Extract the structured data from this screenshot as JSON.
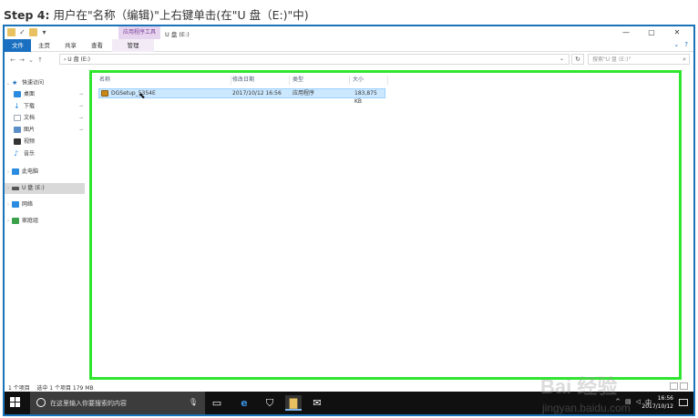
{
  "caption": {
    "step": "Step 4:",
    "text": "用户在\"名称（编辑)\"上右键单击(在\"U 盘（E:)\"中)"
  },
  "window": {
    "title": "U 盘 (E:)",
    "contextual_tab_group": "应用程序工具",
    "controls": {
      "minimize": "—",
      "maximize": "▢",
      "close": "✕"
    }
  },
  "ribbon": {
    "tabs": [
      {
        "label": "文件"
      },
      {
        "label": "主页"
      },
      {
        "label": "共享"
      },
      {
        "label": "查看"
      },
      {
        "label": "管理"
      }
    ],
    "expand": "⌄",
    "help": "?"
  },
  "address": {
    "back": "←",
    "forward": "→",
    "recent": "⌄",
    "up": "↑",
    "path": "› U 盘 (E:)",
    "search_placeholder": "搜索\"U 盘 (E:)\""
  },
  "nav": {
    "items": [
      {
        "label": "快速访问",
        "icon": "star-icon",
        "color": "#1a6fc0"
      },
      {
        "label": "桌面",
        "icon": "desktop-icon",
        "color": "#2a8be0",
        "pinned": true
      },
      {
        "label": "下载",
        "icon": "download-icon",
        "color": "#2a8be0",
        "pinned": true
      },
      {
        "label": "文档",
        "icon": "documents-icon",
        "color": "#9aa5b5",
        "pinned": true
      },
      {
        "label": "图片",
        "icon": "pictures-icon",
        "color": "#5b8fc9",
        "pinned": true
      },
      {
        "label": "视频",
        "icon": "videos-icon",
        "color": "#333333"
      },
      {
        "label": "音乐",
        "icon": "music-icon",
        "color": "#2a8be0"
      },
      {
        "label": "此电脑",
        "icon": "computer-icon",
        "color": "#2a8be0"
      },
      {
        "label": "U 盘 (E:)",
        "icon": "usb-drive-icon",
        "color": "#555555",
        "selected": true
      },
      {
        "label": "网络",
        "icon": "network-icon",
        "color": "#2a8be0"
      },
      {
        "label": "家庭组",
        "icon": "homegroup-icon",
        "color": "#3aa04a"
      }
    ]
  },
  "columns": {
    "name": "名称",
    "modified": "修改日期",
    "type": "类型",
    "size": "大小"
  },
  "files": [
    {
      "name": "DGSetup_5354E",
      "modified": "2017/10/12 16:56",
      "type": "应用程序",
      "size": "183,875 KB"
    }
  ],
  "status": {
    "count": "1 个项目",
    "selected": "选中 1 个项目 179 MB"
  },
  "taskbar": {
    "search_placeholder": "在这里输入你要搜索的内容",
    "time": "16:56",
    "date": "2017/10/12"
  },
  "watermark": {
    "logo": "Bai 经验",
    "url": "jingyan.baidu.com"
  },
  "colors": {
    "highlight": "#2ee62e",
    "file_tab": "#1a6fc0",
    "selection": "#cce8ff"
  }
}
